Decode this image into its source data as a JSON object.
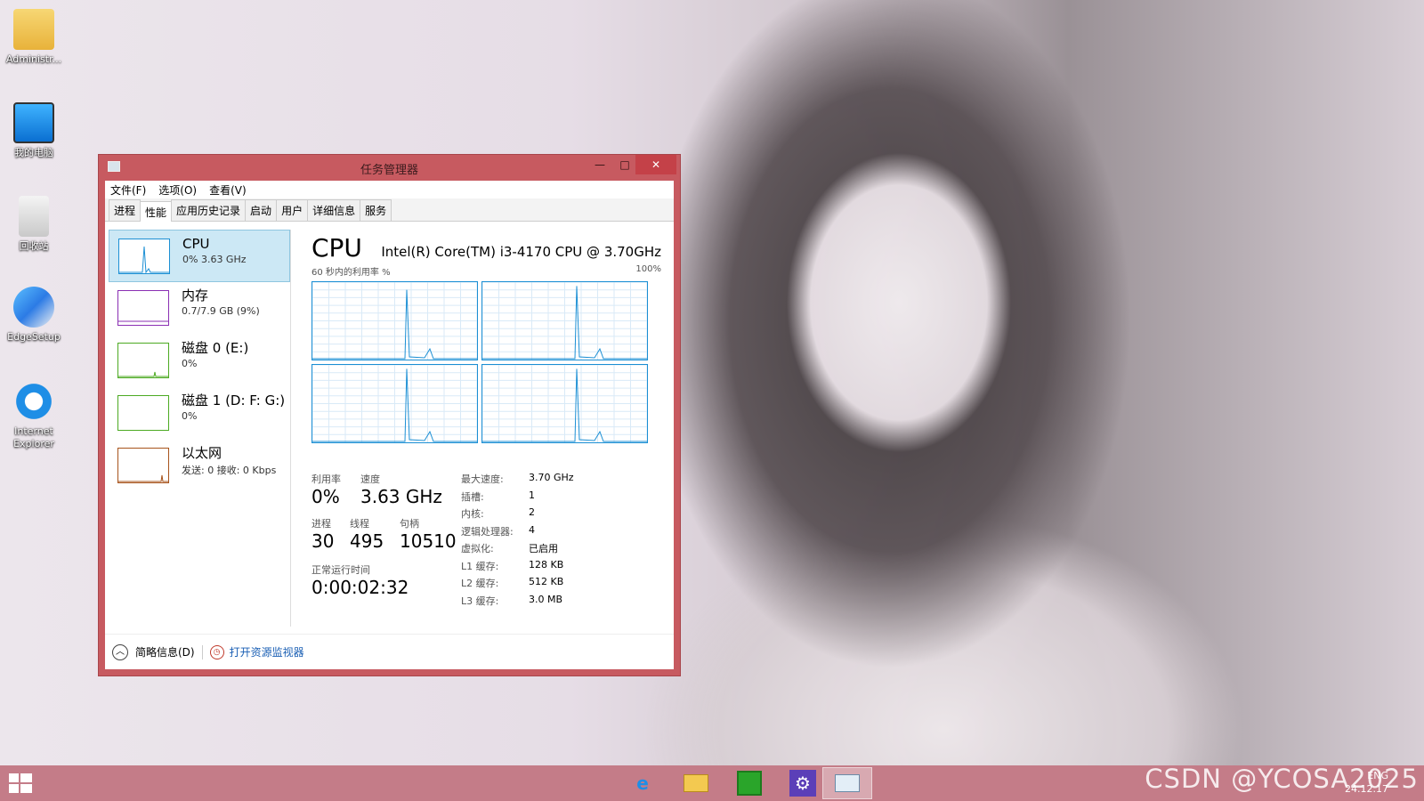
{
  "desktop": {
    "icons": [
      {
        "label": "Administr..."
      },
      {
        "label": "我的电脑"
      },
      {
        "label": "回收站"
      },
      {
        "label": "EdgeSetup"
      },
      {
        "label": "Internet Explorer"
      }
    ]
  },
  "window": {
    "title": "任务管理器",
    "minimize": "—",
    "maximize": "□",
    "close": "✕"
  },
  "menu": [
    "文件(F)",
    "选项(O)",
    "查看(V)"
  ],
  "tabs": [
    "进程",
    "性能",
    "应用历史记录",
    "启动",
    "用户",
    "详细信息",
    "服务"
  ],
  "sidebar": [
    {
      "name": "CPU",
      "sub": "0% 3.63 GHz",
      "color": "#1b8fd4"
    },
    {
      "name": "内存",
      "sub": "0.7/7.9 GB (9%)",
      "color": "#8a2fb3"
    },
    {
      "name": "磁盘 0 (E:)",
      "sub": "0%",
      "color": "#4caa22"
    },
    {
      "name": "磁盘 1 (D: F: G:)",
      "sub": "0%",
      "color": "#4caa22"
    },
    {
      "name": "以太网",
      "sub": "发送: 0 接收: 0 Kbps",
      "color": "#a7531b"
    }
  ],
  "cpu": {
    "title": "CPU",
    "model": "Intel(R) Core(TM) i3-4170 CPU @ 3.70GHz",
    "graph_left_label": "60 秒内的利用率 %",
    "graph_right_label": "100%",
    "stats": {
      "util_label": "利用率",
      "util": "0%",
      "speed_label": "速度",
      "speed": "3.63 GHz",
      "proc_label": "进程",
      "proc": "30",
      "thread_label": "线程",
      "thread": "495",
      "handle_label": "句柄",
      "handle": "10510",
      "uptime_label": "正常运行时间",
      "uptime": "0:00:02:32"
    },
    "specs": [
      {
        "k": "最大速度:",
        "v": "3.70 GHz"
      },
      {
        "k": "插槽:",
        "v": "1"
      },
      {
        "k": "内核:",
        "v": "2"
      },
      {
        "k": "逻辑处理器:",
        "v": "4"
      },
      {
        "k": "虚拟化:",
        "v": "已启用"
      },
      {
        "k": "L1 缓存:",
        "v": "128 KB"
      },
      {
        "k": "L2 缓存:",
        "v": "512 KB"
      },
      {
        "k": "L3 缓存:",
        "v": "3.0 MB"
      }
    ]
  },
  "footer": {
    "brief": "简略信息(D)",
    "resmon": "打开资源监视器"
  },
  "taskbar": {
    "tray_lang": "ENG",
    "tray_date": "24.12.17"
  },
  "watermark": "CSDN @YCOSA2025"
}
